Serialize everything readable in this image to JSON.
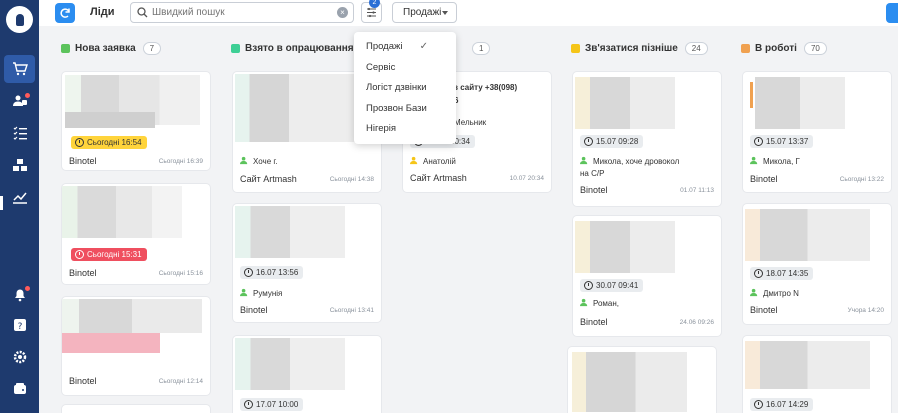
{
  "app": {
    "title": "Ліди",
    "refresh_icon": "refresh-icon"
  },
  "search": {
    "value": "",
    "placeholder": "Швидкий пошук"
  },
  "filter": {
    "badge": "2"
  },
  "funnel": {
    "selected": "Продажі",
    "options": [
      "Продажі",
      "Сервіс",
      "Логіст дзвінки",
      "Прозвон Бази",
      "Нігерія"
    ]
  },
  "sidebar": {
    "items": [
      {
        "name": "cart-icon"
      },
      {
        "name": "users-icon"
      },
      {
        "name": "list-icon"
      },
      {
        "name": "boxes-icon"
      },
      {
        "name": "analytics-icon"
      },
      {
        "name": "bell-icon"
      },
      {
        "name": "help-icon"
      },
      {
        "name": "settings-icon"
      },
      {
        "name": "wallet-icon"
      }
    ]
  },
  "columns": [
    {
      "title": "Нова заявка",
      "count": "7",
      "color": "#5cc35c",
      "cards": [
        {
          "tag": "Сьогодні 16:54",
          "tag_style": "yellow",
          "source": "Binotel",
          "time": "Сьогодні 16:39"
        },
        {
          "tag": "Сьогодні 15:31",
          "tag_style": "red",
          "source": "Binotel",
          "time": "Сьогодні 15:16"
        },
        {
          "source": "Binotel",
          "time": "Сьогодні 12:14"
        }
      ]
    },
    {
      "title": "Взято в опрацювання",
      "count": "",
      "color": "#3ecf95",
      "cards": [
        {
          "person": "Хоче г.",
          "source": "Сайт Artmash",
          "time": "Сьогодні 14:38"
        },
        {
          "tag": "16.07 13:56",
          "tag_style": "grey",
          "person": "Румунія",
          "source": "Binotel",
          "time": "Сьогодні 13:41"
        },
        {
          "tag": "17.07 10:00",
          "tag_style": "grey"
        }
      ]
    },
    {
      "title": "",
      "count": "1",
      "color": "#3ecf95",
      "cards": [
        {
          "line1": "з сайту +38(098)",
          "line2": "6",
          "name": "Мельник",
          "tag": "20:34",
          "tag_style": "grey",
          "person": "Анатолій",
          "source": "Сайт Artmash",
          "time": "10.07 20:34"
        }
      ]
    },
    {
      "title": "Зв'язатися пізніше",
      "count": "24",
      "color": "#f5c518",
      "cards": [
        {
          "tag": "15.07 09:28",
          "tag_style": "grey",
          "person": "Микола, хоче дровокол",
          "person2": "на С/Р",
          "source": "Binotel",
          "time": "01.07 11:13"
        },
        {
          "tag": "30.07 09:41",
          "tag_style": "grey",
          "person": "Роман,",
          "source": "Binotel",
          "time": "24.06 09:26"
        },
        {}
      ]
    },
    {
      "title": "В роботі",
      "count": "70",
      "color": "#f0a150",
      "cards": [
        {
          "tag": "15.07 13:37",
          "tag_style": "grey",
          "person": "Микола, Г",
          "source": "Binotel",
          "time": "Сьогодні 13:22"
        },
        {
          "tag": "18.07 14:35",
          "tag_style": "grey",
          "person": "Дмитро N",
          "source": "Binotel",
          "time": "Учора 14:20"
        },
        {
          "tag": "16.07 14:29",
          "tag_style": "grey"
        }
      ]
    }
  ],
  "colors": {
    "sidebar": "#1e3a6e",
    "accent": "#2b8df0",
    "background": "#f2f3f5"
  }
}
